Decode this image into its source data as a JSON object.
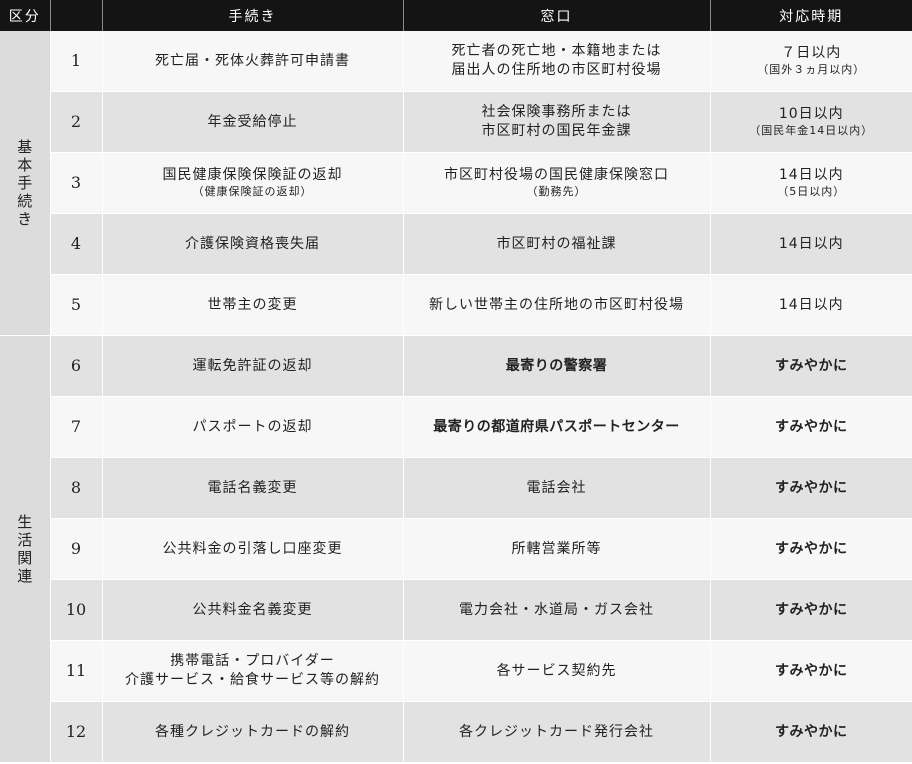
{
  "header": {
    "category": "区分",
    "procedure": "手続き",
    "office": "窓口",
    "timing": "対応時期"
  },
  "categories": {
    "basic": "基本手続き",
    "life": "生活関連"
  },
  "rows": [
    {
      "no": "1",
      "procedure": "死亡届・死体火葬許可申請書",
      "procedure_sub": "",
      "office": "死亡者の死亡地・本籍地または",
      "office2": "届出人の住所地の市区町村役場",
      "office_sub": "",
      "timing": "７日以内",
      "timing_sub": "（国外３ヵ月以内）"
    },
    {
      "no": "2",
      "procedure": "年金受給停止",
      "procedure_sub": "",
      "office": "社会保険事務所または",
      "office2": "市区町村の国民年金課",
      "office_sub": "",
      "timing": "10日以内",
      "timing_sub": "（国民年金14日以内）"
    },
    {
      "no": "3",
      "procedure": "国民健康保険保険証の返却",
      "procedure_sub": "（健康保険証の返却）",
      "office": "市区町村役場の国民健康保険窓口",
      "office2": "",
      "office_sub": "（勤務先）",
      "timing": "14日以内",
      "timing_sub": "（5日以内）"
    },
    {
      "no": "4",
      "procedure": "介護保険資格喪失届",
      "procedure_sub": "",
      "office": "市区町村の福祉課",
      "office2": "",
      "office_sub": "",
      "timing": "14日以内",
      "timing_sub": ""
    },
    {
      "no": "5",
      "procedure": "世帯主の変更",
      "procedure_sub": "",
      "office": "新しい世帯主の住所地の市区町村役場",
      "office2": "",
      "office_sub": "",
      "timing": "14日以内",
      "timing_sub": ""
    },
    {
      "no": "6",
      "procedure": "運転免許証の返却",
      "procedure_sub": "",
      "office": "最寄りの警察署",
      "office2": "",
      "office_sub": "",
      "timing": "すみやかに",
      "timing_sub": ""
    },
    {
      "no": "7",
      "procedure": "パスポートの返却",
      "procedure_sub": "",
      "office": "最寄りの都道府県パスポートセンター",
      "office2": "",
      "office_sub": "",
      "timing": "すみやかに",
      "timing_sub": ""
    },
    {
      "no": "8",
      "procedure": "電話名義変更",
      "procedure_sub": "",
      "office": "電話会社",
      "office2": "",
      "office_sub": "",
      "timing": "すみやかに",
      "timing_sub": ""
    },
    {
      "no": "9",
      "procedure": "公共料金の引落し口座変更",
      "procedure_sub": "",
      "office": "所轄営業所等",
      "office2": "",
      "office_sub": "",
      "timing": "すみやかに",
      "timing_sub": ""
    },
    {
      "no": "10",
      "procedure": "公共料金名義変更",
      "procedure_sub": "",
      "office": "電力会社・水道局・ガス会社",
      "office2": "",
      "office_sub": "",
      "timing": "すみやかに",
      "timing_sub": ""
    },
    {
      "no": "11",
      "procedure": "携帯電話・プロバイダー",
      "procedure2": "介護サービス・給食サービス等の解約",
      "procedure_sub": "",
      "office": "各サービス契約先",
      "office2": "",
      "office_sub": "",
      "timing": "すみやかに",
      "timing_sub": ""
    },
    {
      "no": "12",
      "procedure": "各種クレジットカードの解約",
      "procedure_sub": "",
      "office": "各クレジットカード発行会社",
      "office2": "",
      "office_sub": "",
      "timing": "すみやかに",
      "timing_sub": ""
    }
  ]
}
